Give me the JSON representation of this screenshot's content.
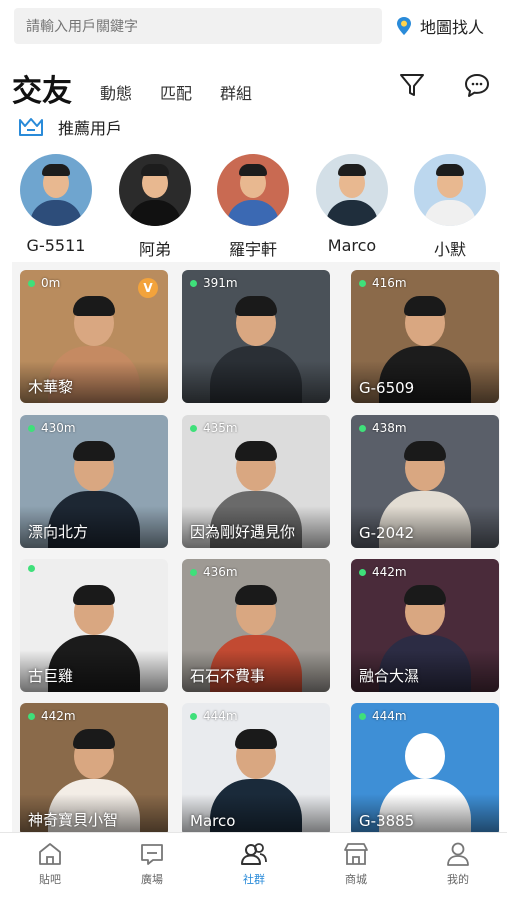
{
  "search": {
    "placeholder": "請輸入用戶關鍵字",
    "map_label": "地圖找人"
  },
  "header": {
    "title": "交友",
    "tabs": [
      {
        "label": "動態"
      },
      {
        "label": "匹配"
      },
      {
        "label": "群組"
      }
    ]
  },
  "recommended": {
    "label": "推薦用戶",
    "users": [
      {
        "name": "G-5511",
        "bg": "#6fa5cf",
        "shirt": "#2d4d7a"
      },
      {
        "name": "阿弟",
        "bg": "#2b2b2b",
        "shirt": "#111111"
      },
      {
        "name": "羅宇軒",
        "bg": "#c96a52",
        "shirt": "#3b69b3"
      },
      {
        "name": "Marco",
        "bg": "#d3dfe7",
        "shirt": "#1f2e3c"
      },
      {
        "name": "小默",
        "bg": "#bcd7ee",
        "shirt": "#f0f0f0"
      }
    ]
  },
  "cards": [
    {
      "name": "木華黎",
      "distance": "0m",
      "online": true,
      "vip": true,
      "bg": "#b98c5e",
      "body": "#c58a62"
    },
    {
      "name": "",
      "distance": "391m",
      "online": true,
      "vip": false,
      "bg": "#4a5158",
      "body": "#2a2f35"
    },
    {
      "name": "G-6509",
      "distance": "416m",
      "online": true,
      "vip": false,
      "bg": "#8b6a4a",
      "body": "#1c1c1c"
    },
    {
      "name": "漂向北方",
      "distance": "430m",
      "online": true,
      "vip": false,
      "bg": "#8fa3b2",
      "body": "#1d2733"
    },
    {
      "name": "因為剛好遇見你",
      "distance": "435m",
      "online": true,
      "vip": false,
      "bg": "#dcdcdc",
      "body": "#6a6a6a"
    },
    {
      "name": "G-2042",
      "distance": "438m",
      "online": true,
      "vip": false,
      "bg": "#5a5f69",
      "body": "#e3ddd3"
    },
    {
      "name": "古巨雞",
      "distance": "",
      "online": true,
      "vip": false,
      "bg": "#eeeeee",
      "body": "#1b1b1b"
    },
    {
      "name": "石石不費事",
      "distance": "436m",
      "online": true,
      "vip": false,
      "bg": "#9e9a94",
      "body": "#c24a32"
    },
    {
      "name": "融合大濕",
      "distance": "442m",
      "online": true,
      "vip": false,
      "bg": "#4a2b3a",
      "body": "#2c2c44"
    },
    {
      "name": "神奇寶貝小智",
      "distance": "442m",
      "online": true,
      "vip": false,
      "bg": "#8a6a4a",
      "body": "#f3ede6"
    },
    {
      "name": "Marco",
      "distance": "444m",
      "online": true,
      "vip": false,
      "bg": "#e9ebee",
      "body": "#1a2a3a"
    },
    {
      "name": "G-3885",
      "distance": "444m",
      "online": true,
      "vip": false,
      "bg": "#3e8fd6",
      "body": "#ffffff"
    }
  ],
  "nav": [
    {
      "label": "貼吧",
      "icon": "home-icon",
      "active": false
    },
    {
      "label": "廣場",
      "icon": "chat-square-icon",
      "active": false
    },
    {
      "label": "社群",
      "icon": "people-icon",
      "active": true
    },
    {
      "label": "商城",
      "icon": "store-icon",
      "active": false
    },
    {
      "label": "我的",
      "icon": "profile-icon",
      "active": false
    }
  ],
  "colors": {
    "accent": "#2a8bd9",
    "online": "#3fe07a",
    "vip": "#f3a33b"
  }
}
